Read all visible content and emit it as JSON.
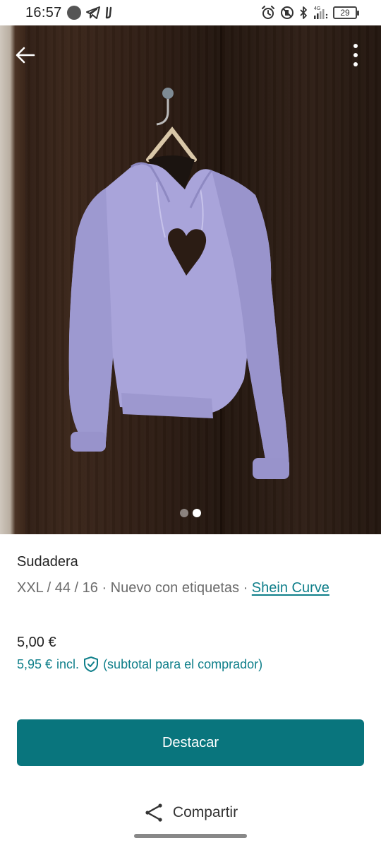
{
  "status_bar": {
    "time": "16:57",
    "network": "4G",
    "battery": "29"
  },
  "photo": {
    "pager": {
      "count": 2,
      "active_index": 1
    },
    "colors": {
      "hoodie": "#a9a4da",
      "wood": "#2e1d14"
    }
  },
  "listing": {
    "title": "Sudadera",
    "meta_prefix": "XXL / 44 / 16 · Nuevo con etiquetas · ",
    "brand": "Shein Curve",
    "price": "5,00 €",
    "buyer_price": "5,95 €",
    "incl_label": "incl.",
    "buyer_note": "(subtotal para el comprador)"
  },
  "actions": {
    "primary_label": "Destacar",
    "share_label": "Compartir"
  },
  "colors": {
    "accent": "#09757d",
    "link": "#0f7f8a"
  }
}
